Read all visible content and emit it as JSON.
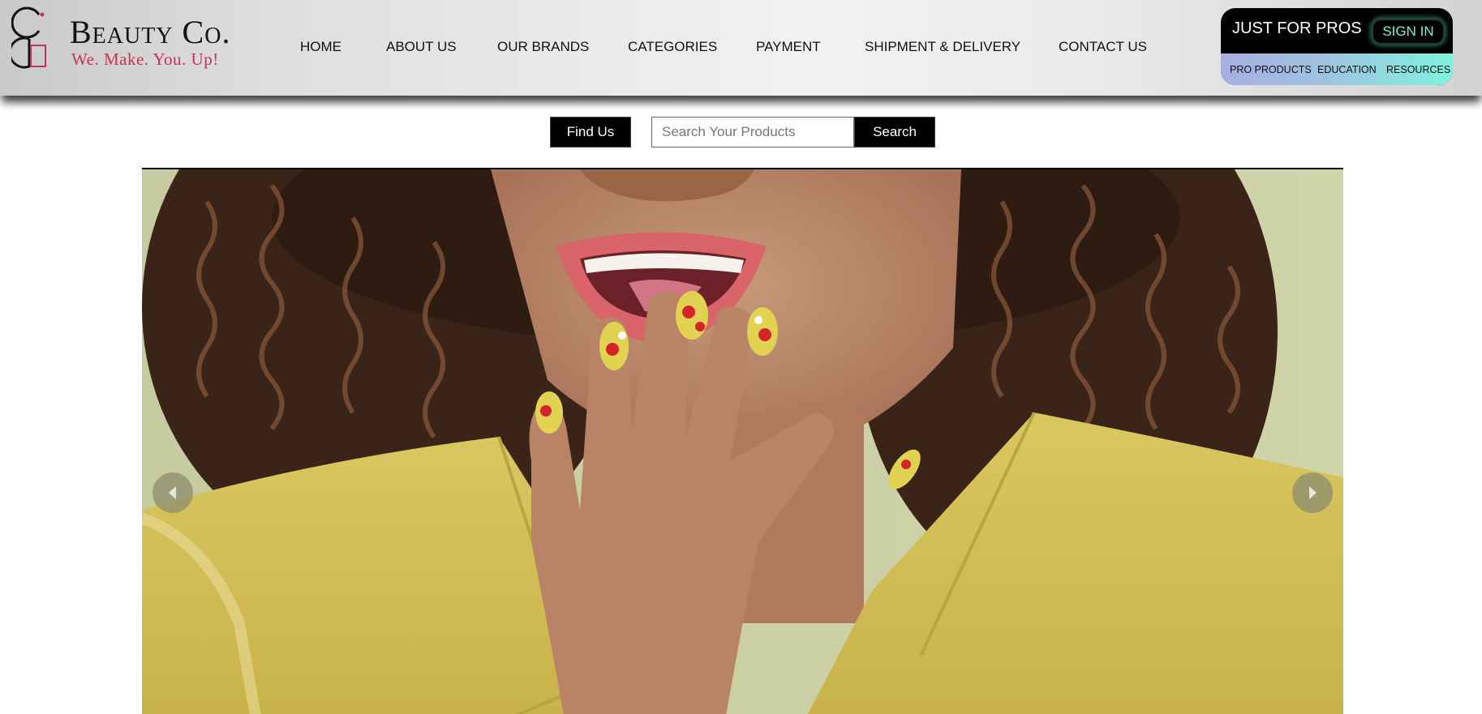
{
  "brand": {
    "name": "Beauty Co.",
    "tagline": "We. Make. You. Up!",
    "accent_color": "#c8315a"
  },
  "nav": {
    "items": [
      {
        "label": "HOME"
      },
      {
        "label": "ABOUT US"
      },
      {
        "label": "OUR BRANDS"
      },
      {
        "label": "CATEGORIES"
      },
      {
        "label": "PAYMENT"
      },
      {
        "label": "SHIPMENT & DELIVERY"
      },
      {
        "label": "CONTACT US"
      }
    ]
  },
  "pro_panel": {
    "title": "JUST FOR PROS",
    "sign_in_label": "SIGN IN",
    "links": [
      {
        "label": "PRO PRODUCTS"
      },
      {
        "label": "EDUCATION"
      },
      {
        "label": "RESOURCES"
      }
    ],
    "accent_color": "#6ef5d4"
  },
  "search": {
    "find_us_label": "Find Us",
    "placeholder": "Search Your Products",
    "value": "",
    "button_label": "Search"
  },
  "hero": {
    "slide_icons": {
      "prev": "chevron-left-icon",
      "next": "chevron-right-icon"
    },
    "background_color": "#cfd2a6",
    "jacket_color": "#d8c45a"
  }
}
